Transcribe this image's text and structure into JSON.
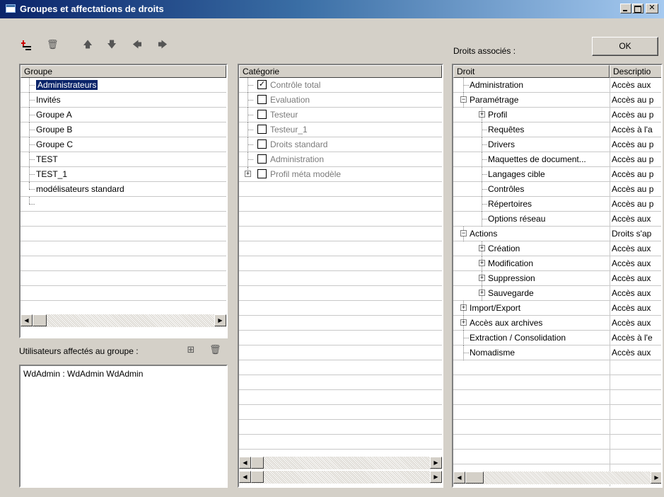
{
  "window": {
    "title": "Groupes et affectations de droits",
    "min_glyph": "_",
    "max_glyph": "□",
    "close_glyph": "✕"
  },
  "toolbar": {
    "icons": [
      "add-group-icon",
      "delete-icon",
      "arrow-up-icon",
      "arrow-down-icon",
      "arrow-left-icon",
      "arrow-right-icon"
    ]
  },
  "ok_label": "OK",
  "rights_label": "Droits associés :",
  "groups": {
    "header": "Groupe",
    "items": [
      "Administrateurs",
      "Invités",
      "Groupe A",
      "Groupe B",
      "Groupe C",
      "TEST",
      "TEST_1",
      "modélisateurs standard"
    ],
    "selected": "Administrateurs"
  },
  "users": {
    "label": "Utilisateurs affectés au groupe :",
    "items": [
      "WdAdmin : WdAdmin WdAdmin"
    ]
  },
  "categories": {
    "header": "Catégorie",
    "items": [
      {
        "label": "Contrôle total",
        "checked": true
      },
      {
        "label": "Evaluation",
        "checked": false
      },
      {
        "label": "Testeur",
        "checked": false
      },
      {
        "label": "Testeur_1",
        "checked": false
      },
      {
        "label": "Droits standard",
        "checked": false
      },
      {
        "label": "Administration",
        "checked": false
      },
      {
        "label": "Profil méta modèle",
        "checked": false,
        "expandable": true
      }
    ]
  },
  "rights": {
    "headers": [
      "Droit",
      "Descriptio"
    ],
    "rows": [
      {
        "label": "Administration",
        "desc": "Accès aux",
        "level": 0,
        "exp": ""
      },
      {
        "label": "Paramétrage",
        "desc": "Accès au p",
        "level": 0,
        "exp": "−"
      },
      {
        "label": "Profil",
        "desc": "Accès au p",
        "level": 1,
        "exp": "+"
      },
      {
        "label": "Requêtes",
        "desc": "Accès à l'a",
        "level": 1,
        "exp": ""
      },
      {
        "label": "Drivers",
        "desc": "Accès au p",
        "level": 1,
        "exp": ""
      },
      {
        "label": "Maquettes de document...",
        "desc": "Accès au p",
        "level": 1,
        "exp": ""
      },
      {
        "label": "Langages cible",
        "desc": "Accès au p",
        "level": 1,
        "exp": ""
      },
      {
        "label": "Contrôles",
        "desc": "Accès au p",
        "level": 1,
        "exp": ""
      },
      {
        "label": "Répertoires",
        "desc": "Accès au p",
        "level": 1,
        "exp": ""
      },
      {
        "label": "Options réseau",
        "desc": "Accès aux",
        "level": 1,
        "exp": ""
      },
      {
        "label": "Actions",
        "desc": "Droits s'ap",
        "level": 0,
        "exp": "−"
      },
      {
        "label": "Création",
        "desc": "Accès aux",
        "level": 1,
        "exp": "+"
      },
      {
        "label": "Modification",
        "desc": "Accès aux",
        "level": 1,
        "exp": "+"
      },
      {
        "label": "Suppression",
        "desc": "Accès aux",
        "level": 1,
        "exp": "+"
      },
      {
        "label": "Sauvegarde",
        "desc": "Accès aux",
        "level": 1,
        "exp": "+"
      },
      {
        "label": "Import/Export",
        "desc": "Accès aux",
        "level": 0,
        "exp": "+"
      },
      {
        "label": "Accès aux archives",
        "desc": "Accès aux",
        "level": 0,
        "exp": "+"
      },
      {
        "label": "Extraction / Consolidation",
        "desc": "Accès à l'e",
        "level": 0,
        "exp": ""
      },
      {
        "label": "Nomadisme",
        "desc": "Accès aux",
        "level": 0,
        "exp": ""
      }
    ]
  }
}
